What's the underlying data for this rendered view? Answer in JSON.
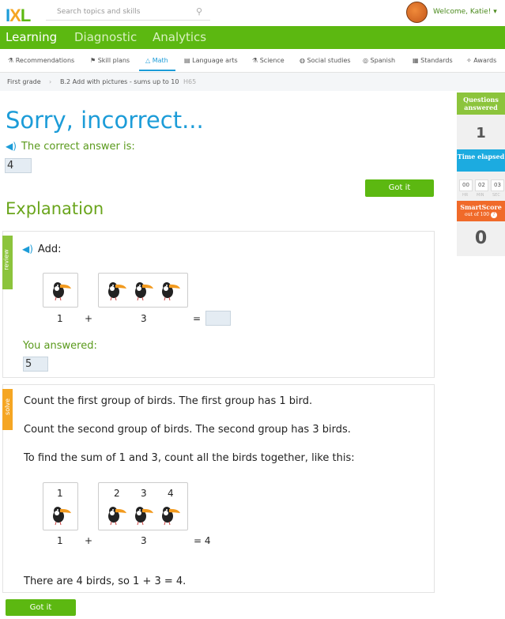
{
  "header": {
    "logo": "IXL",
    "search_placeholder": "Search topics and skills",
    "welcome": "Welcome, Katie!"
  },
  "main_nav": [
    "Learning",
    "Diagnostic",
    "Analytics"
  ],
  "subnav": [
    "Recommendations",
    "Skill plans",
    "Math",
    "Language arts",
    "Science",
    "Social studies",
    "Spanish",
    "Standards",
    "Awards"
  ],
  "breadcrumb": {
    "grade": "First grade",
    "skill": "B.2 Add with pictures - sums up to 10",
    "code": "H65"
  },
  "sidebar": {
    "questions_label": "Questions answered",
    "questions": "1",
    "time_label": "Time elapsed",
    "hr": "00",
    "min": "02",
    "sec": "03",
    "hr_l": "HR",
    "min_l": "MIN",
    "sec_l": "SEC",
    "score_label": "SmartScore",
    "score_sub": "out of 100",
    "score": "0"
  },
  "feedback": {
    "title": "Sorry, incorrect...",
    "correct_label": "The correct answer is:",
    "correct_answer": "4",
    "got_it": "Got it"
  },
  "explanation": {
    "title": "Explanation",
    "review_tab": "review",
    "add_label": "Add:",
    "n1": "1",
    "plus": "+",
    "n2": "3",
    "eq": "=",
    "you_answered": "You answered:",
    "user_answer": "5",
    "solve_tab": "solve",
    "lines": [
      "Count the first group of birds. The first group has 1 bird.",
      "Count the second group of birds. The second group has 3 birds.",
      "To find the sum of 1 and 3, count all the birds together, like this:"
    ],
    "counts": [
      "1",
      "2",
      "3",
      "4"
    ],
    "result": "= 4",
    "conclusion": "There are 4 birds, so 1 + 3 = 4.",
    "got_it": "Got it"
  },
  "colors": {
    "green": "#5cb811",
    "blue": "#1c9cd8",
    "orange": "#f06a2a"
  }
}
